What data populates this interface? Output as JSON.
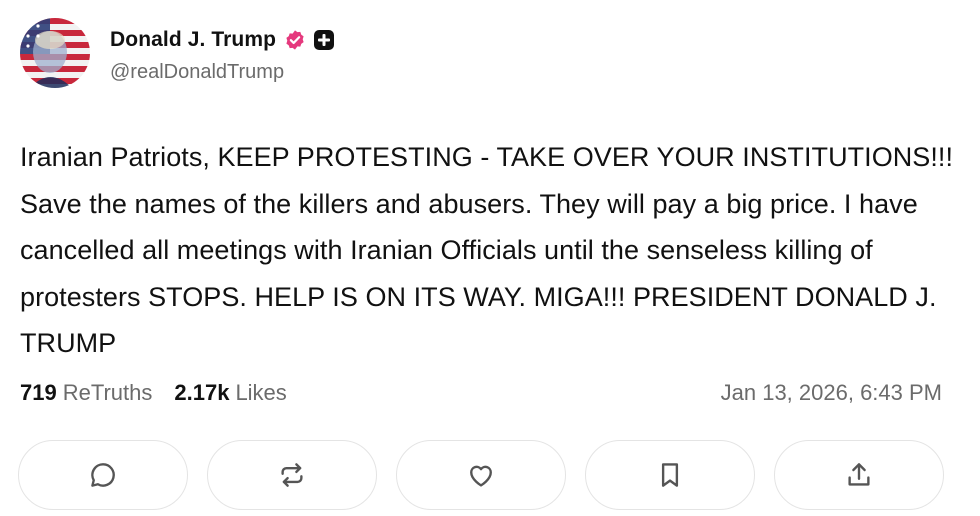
{
  "author": {
    "display_name": "Donald J. Trump",
    "handle": "@realDonaldTrump",
    "avatar_icon": "flag-portrait-avatar",
    "verified_color": "#e5397d"
  },
  "post": {
    "text": "Iranian Patriots, KEEP PROTESTING - TAKE OVER YOUR INSTITUTIONS!!! Save the names of the killers and abusers. They will pay a big price. I have cancelled all meetings with Iranian Officials until the senseless killing of protesters STOPS. HELP IS ON ITS WAY. MIGA!!! PRESIDENT DONALD J. TRUMP"
  },
  "stats": {
    "retruths_count": "719",
    "retruths_label": "ReTruths",
    "likes_count": "2.17k",
    "likes_label": "Likes",
    "timestamp": "Jan 13, 2026, 6:43 PM"
  },
  "actions": [
    {
      "icon": "comment-icon"
    },
    {
      "icon": "retruth-icon"
    },
    {
      "icon": "like-icon"
    },
    {
      "icon": "bookmark-icon"
    },
    {
      "icon": "share-icon"
    }
  ]
}
